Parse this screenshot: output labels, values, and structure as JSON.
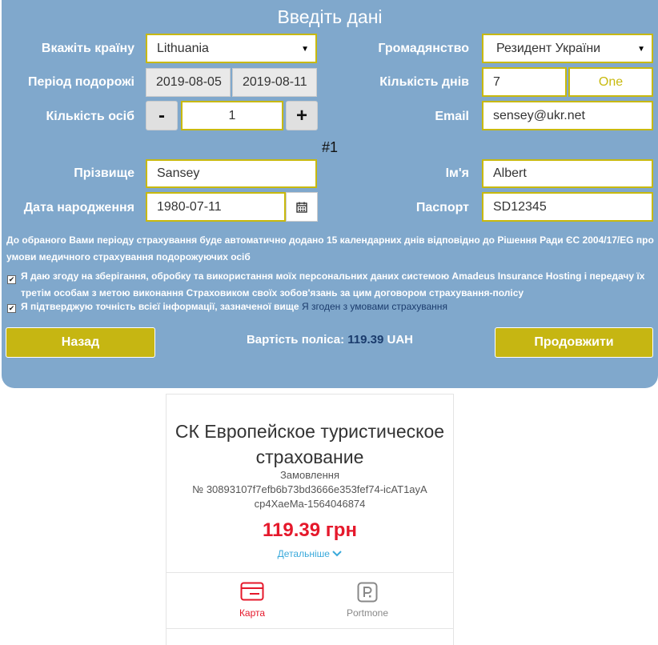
{
  "form": {
    "title": "Введіть дані",
    "country": {
      "label": "Вкажіть країну",
      "value": "Lithuania"
    },
    "citizenship": {
      "label": "Громадянство",
      "value": "Резидент України"
    },
    "period": {
      "label": "Період подорожі",
      "from": "2019-08-05",
      "to": "2019-08-11"
    },
    "days": {
      "label": "Кількість днів",
      "value": "7",
      "button": "One"
    },
    "persons": {
      "label": "Кількість осіб",
      "minus": "-",
      "value": "1",
      "plus": "+"
    },
    "email": {
      "label": "Email",
      "value": "sensey@ukr.net"
    },
    "person_number": "#1",
    "surname": {
      "label": "Прізвище",
      "value": "Sansey"
    },
    "name": {
      "label": "Ім'я",
      "value": "Albert"
    },
    "birthdate": {
      "label": "Дата народження",
      "value": "1980-07-11"
    },
    "passport": {
      "label": "Паспорт",
      "value": "SD12345"
    },
    "note": "До обраного Вами періоду страхування буде автоматично додано 15 календарних днів відповідно до Рішення Ради ЄС 2004/17/EG про умови медичного страхування подорожуючих осіб",
    "consent1": {
      "text": "Я даю згоду на зберігання, обробку та використання моїх персональних даних системою Amadeus Insurance Hosting і передачу їх третім особам з метою виконання Страховиком своїх зобов'язань за цим договором страхування-полісу",
      "checked": true
    },
    "consent2": {
      "text": "Я підтверджую точність всієї інформації, зазначеної вище",
      "link": "Я згоден з умовами страхування",
      "checked": true
    },
    "back_button": "Назад",
    "continue_button": "Продовжити",
    "cost_label": "Вартість поліса:",
    "cost_value": "119.39",
    "cost_currency": "UAH"
  },
  "payment": {
    "company": "СК Европейское туристическое страхование",
    "order_label": "Замовлення",
    "order_number": "№ 30893107f7efb6b73bd3666e353fef74-icAT1ayAcp4XaeMa-1564046874",
    "amount": "119.39 грн",
    "details_link": "Детальніше",
    "methods": [
      {
        "name": "Карта",
        "active": true
      },
      {
        "name": "Portmone",
        "active": false
      }
    ]
  },
  "colors": {
    "panel": "#80a8cc",
    "accent": "#c6b612",
    "amount": "#e5182b",
    "link": "#39a9db",
    "cost_value": "#1b3c6d"
  }
}
